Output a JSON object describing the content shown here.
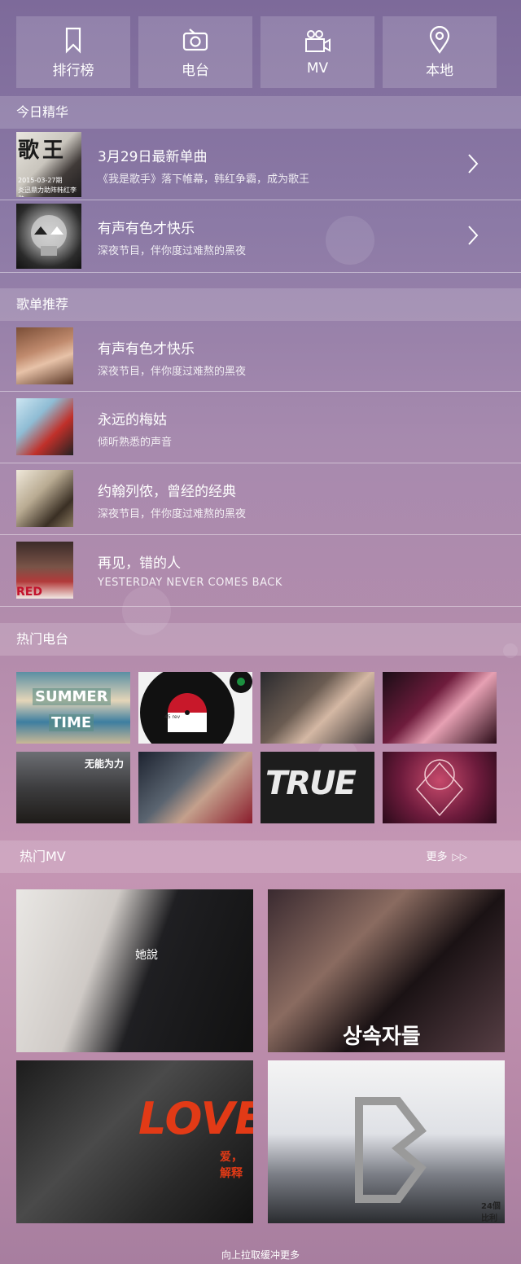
{
  "nav": [
    {
      "label": "排行榜",
      "icon": "bookmark-icon"
    },
    {
      "label": "电台",
      "icon": "radio-icon"
    },
    {
      "label": "MV",
      "icon": "video-camera-icon"
    },
    {
      "label": "本地",
      "icon": "location-pin-icon"
    }
  ],
  "today": {
    "header": "今日精华",
    "items": [
      {
        "title": "3月29日最新单曲",
        "subtitle": "《我是歌手》落下帷幕，韩红争霸，成为歌王",
        "thumb_text": "歌王",
        "thumb_date": "2015-03-27期",
        "thumb_caption": "炎迅鼎力助阵韩红李健"
      },
      {
        "title": "有声有色才快乐",
        "subtitle": "深夜节目，伴你度过难熬的黑夜"
      }
    ]
  },
  "playlists": {
    "header": "歌单推荐",
    "items": [
      {
        "title": "有声有色才快乐",
        "subtitle": "深夜节目，伴你度过难熬的黑夜"
      },
      {
        "title": "永远的梅姑",
        "subtitle": "倾听熟悉的声音"
      },
      {
        "title": "约翰列侬，曾经的经典",
        "subtitle": "深夜节目，伴你度过难熬的黑夜"
      },
      {
        "title": "再见，错的人",
        "subtitle": "YESTERDAY NEVER COMES BACK",
        "thumb_text": "RED"
      }
    ]
  },
  "radio": {
    "header": "热门电台",
    "tiles": [
      "SUMMER",
      "TIME",
      "45 rev",
      "",
      "",
      "无能为力",
      "",
      "TRUE",
      ""
    ]
  },
  "mv": {
    "header": "热门MV",
    "more_label": "更多",
    "more_icon": "double-chevron-right-icon",
    "tiles": [
      {
        "caption": "她說"
      },
      {
        "caption": "상속자들"
      },
      {
        "caption": "LOVE",
        "sub": "爱，解释"
      },
      {
        "caption": "24個比利"
      }
    ]
  },
  "footer": "向上拉取缓冲更多"
}
